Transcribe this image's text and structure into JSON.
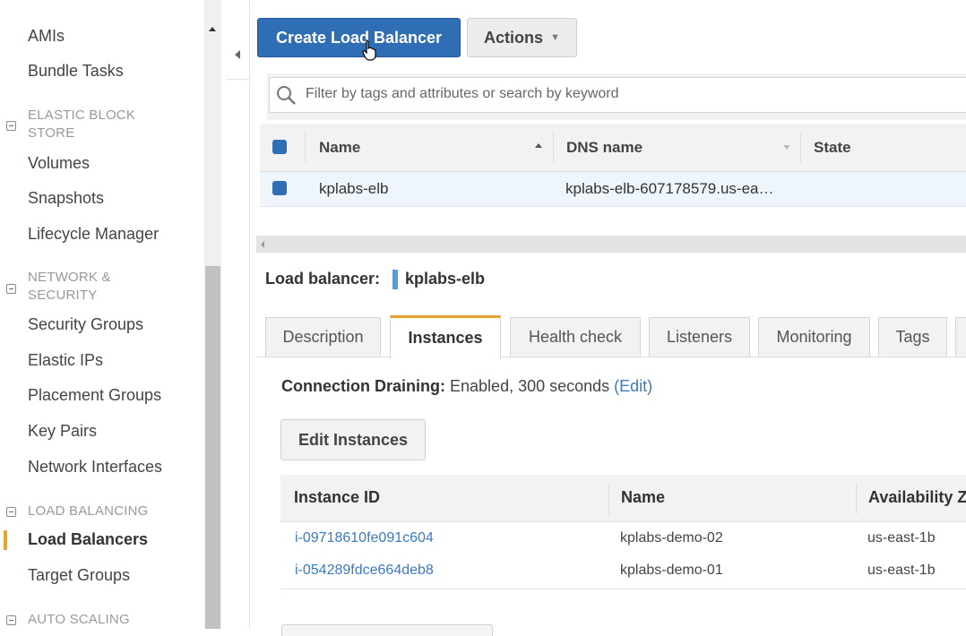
{
  "sidebar": {
    "items": [
      {
        "label": "AMIs"
      },
      {
        "label": "Bundle Tasks"
      },
      {
        "label": "Volumes"
      },
      {
        "label": "Snapshots"
      },
      {
        "label": "Lifecycle Manager"
      },
      {
        "label": "Security Groups"
      },
      {
        "label": "Elastic IPs"
      },
      {
        "label": "Placement Groups"
      },
      {
        "label": "Key Pairs"
      },
      {
        "label": "Network Interfaces"
      },
      {
        "label": "Load Balancers"
      },
      {
        "label": "Target Groups"
      }
    ],
    "sections": {
      "ebs_line1": "ELASTIC BLOCK",
      "ebs_line2": "STORE",
      "net_line1": "NETWORK &",
      "net_line2": "SECURITY",
      "lb": "LOAD BALANCING",
      "as": "AUTO SCALING"
    },
    "active_item": "Load Balancers"
  },
  "toolbar": {
    "create_label": "Create Load Balancer",
    "actions_label": "Actions"
  },
  "filter": {
    "placeholder": "Filter by tags and attributes or search by keyword"
  },
  "grid": {
    "columns": [
      "Name",
      "DNS name",
      "State"
    ],
    "rows": [
      {
        "name": "kplabs-elb",
        "dns": "kplabs-elb-607178579.us-ea…",
        "state": ""
      }
    ]
  },
  "details": {
    "label": "Load balancer:",
    "name": "kplabs-elb",
    "tabs": [
      "Description",
      "Instances",
      "Health check",
      "Listeners",
      "Monitoring",
      "Tags"
    ],
    "active_tab": "Instances",
    "draining_label": "Connection Draining:",
    "draining_value": "Enabled, 300 seconds",
    "draining_edit": "(Edit)",
    "edit_instances_label": "Edit Instances",
    "instances": {
      "columns": [
        "Instance ID",
        "Name",
        "Availability Z"
      ],
      "rows": [
        {
          "id": "i-09718610fe091c604",
          "name": "kplabs-demo-02",
          "az": "us-east-1b"
        },
        {
          "id": "i-054289fdce664deb8",
          "name": "kplabs-demo-01",
          "az": "us-east-1b"
        }
      ]
    }
  },
  "colors": {
    "primary": "#2f6db4",
    "accent": "#e7a32b",
    "link": "#3a7ac2"
  },
  "icons": [
    "search-icon",
    "chevron-down-icon",
    "collapse-left-icon",
    "mouse-cursor-icon",
    "sort-asc-icon",
    "sort-desc-icon"
  ]
}
